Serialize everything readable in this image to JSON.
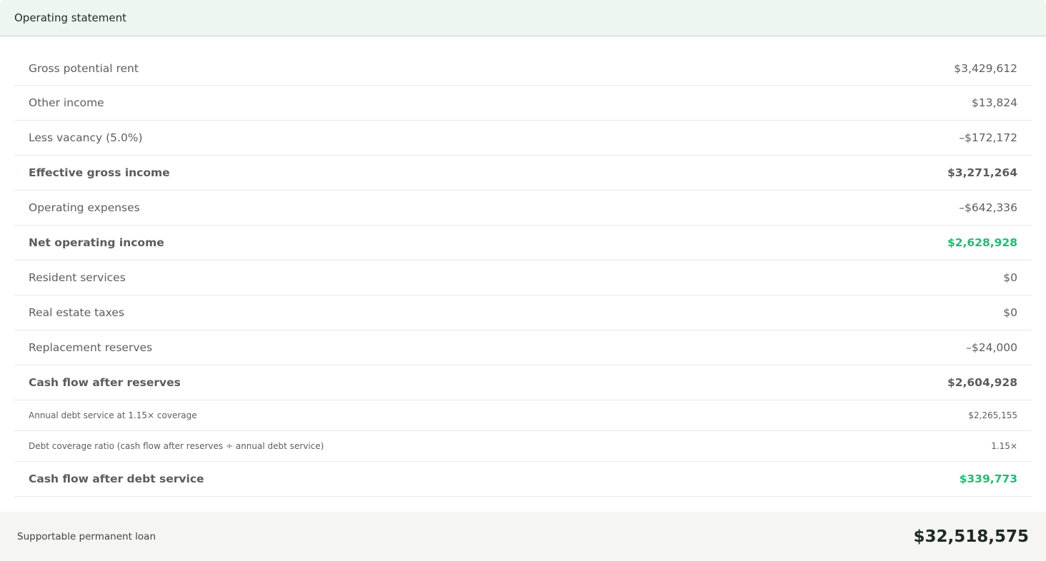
{
  "header": {
    "title": "Operating statement"
  },
  "rows": [
    {
      "label": "Gross potential rent",
      "value": "$3,429,612"
    },
    {
      "label": "Other income",
      "value": "$13,824"
    },
    {
      "label": "Less vacancy (5.0%)",
      "value": "–$172,172"
    },
    {
      "label": "Effective gross income",
      "value": "$3,271,264"
    },
    {
      "label": "Operating expenses",
      "value": "–$642,336"
    },
    {
      "label": "Net operating income",
      "value": "$2,628,928"
    },
    {
      "label": "Resident services",
      "value": "$0"
    },
    {
      "label": "Real estate taxes",
      "value": "$0"
    },
    {
      "label": "Replacement reserves",
      "value": "–$24,000"
    },
    {
      "label": "Cash flow after reserves",
      "value": "$2,604,928"
    },
    {
      "label": "Annual debt service at 1.15× coverage",
      "value": "$2,265,155"
    },
    {
      "label": "Debt coverage ratio (cash flow after reserves ÷ annual debt service)",
      "value": "1.15×"
    },
    {
      "label": "Cash flow after debt service",
      "value": "$339,773"
    }
  ],
  "footer": {
    "label": "Supportable permanent loan",
    "value": "$32,518,575"
  },
  "colors": {
    "positive_highlight": "#1fbd71",
    "header_background": "#edf6f1",
    "footer_background": "#f5f5f4"
  }
}
